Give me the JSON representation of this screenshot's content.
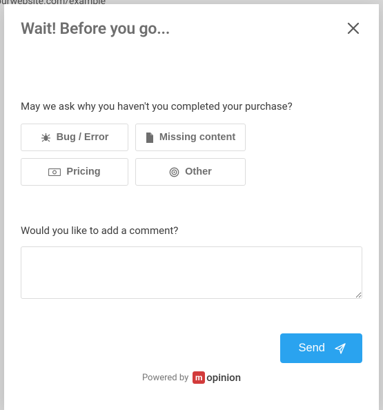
{
  "background_url": "ourwebsite.com/example",
  "modal": {
    "title": "Wait! Before you go..."
  },
  "question1": {
    "label": "May we ask why you haven't you completed your purchase?",
    "options": [
      {
        "icon": "bug-icon",
        "label": "Bug / Error"
      },
      {
        "icon": "file-icon",
        "label": "Missing content"
      },
      {
        "icon": "money-icon",
        "label": "Pricing"
      },
      {
        "icon": "target-icon",
        "label": "Other"
      }
    ]
  },
  "question2": {
    "label": "Would you like to add a comment?",
    "value": ""
  },
  "actions": {
    "send_label": "Send"
  },
  "footer": {
    "powered_by": "Powered by",
    "brand_letter": "m",
    "brand_rest": "opinion"
  }
}
